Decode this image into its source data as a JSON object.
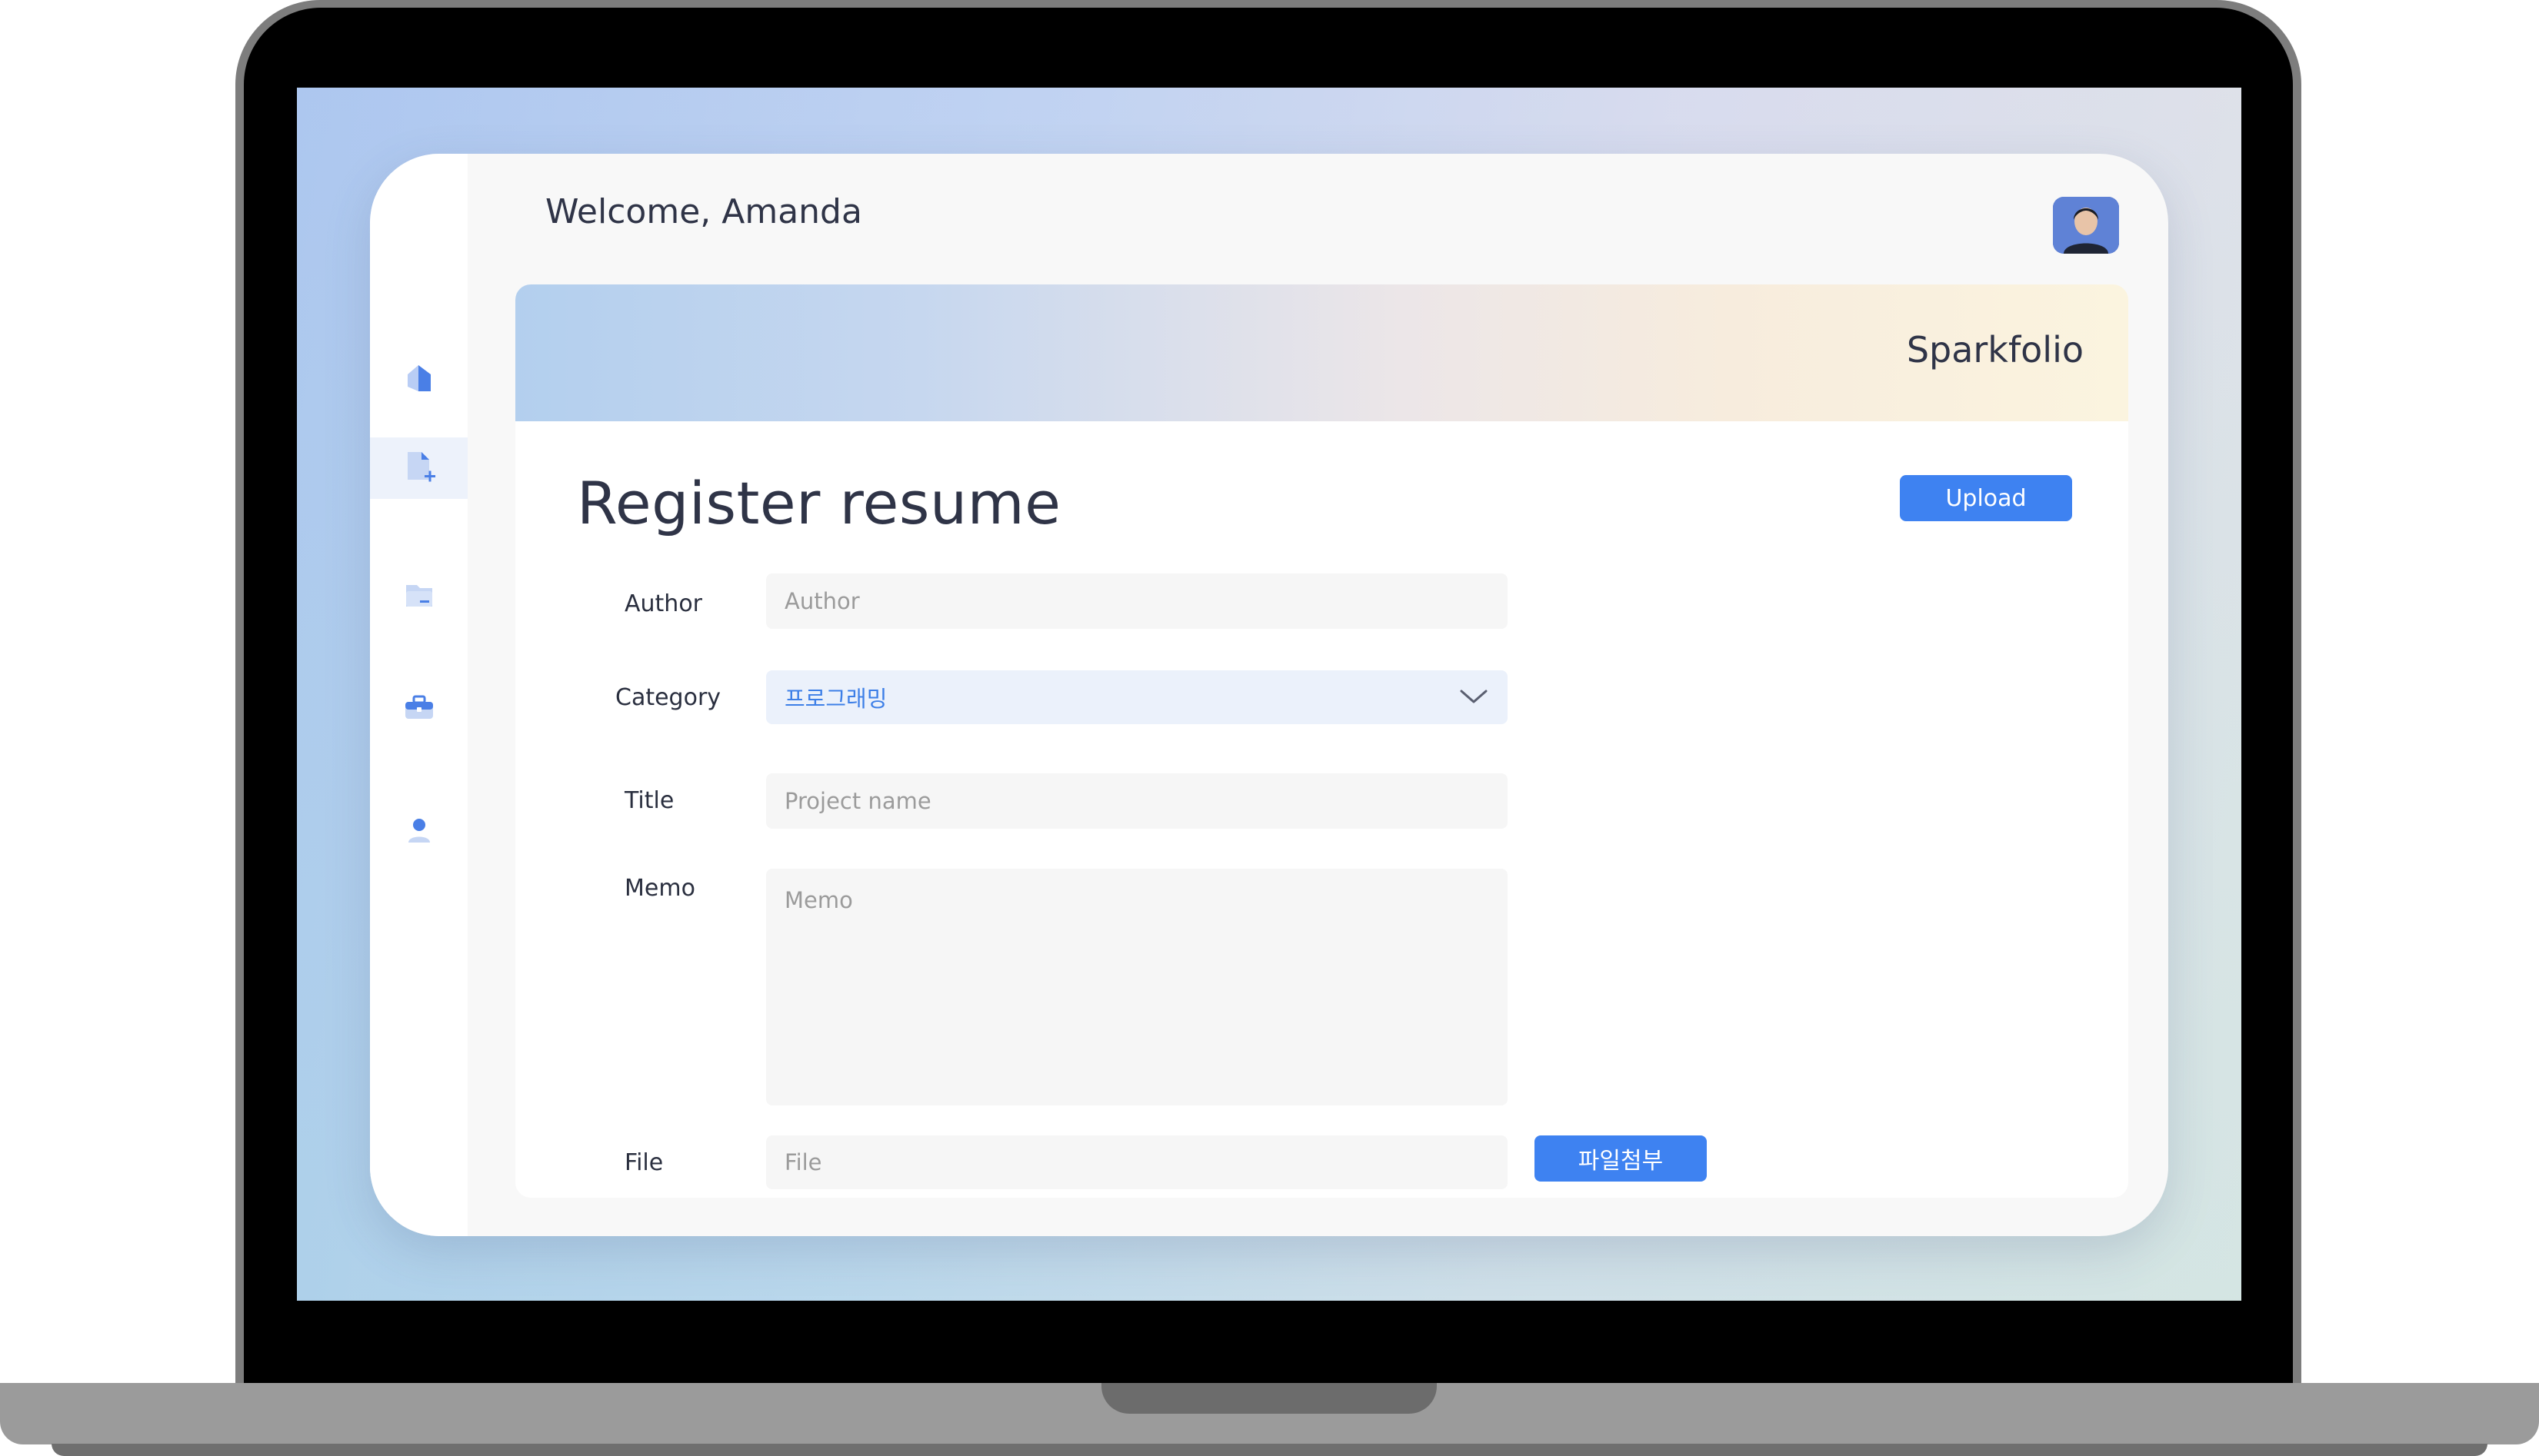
{
  "header": {
    "welcome": "Welcome, Amanda"
  },
  "banner": {
    "brand": "Sparkfolio"
  },
  "sidebar": {
    "items": [
      {
        "icon": "home-icon",
        "active": false
      },
      {
        "icon": "add-document-icon",
        "active": true
      },
      {
        "icon": "folder-icon",
        "active": false
      },
      {
        "icon": "briefcase-icon",
        "active": false
      },
      {
        "icon": "user-icon",
        "active": false
      }
    ]
  },
  "form": {
    "title": "Register resume",
    "upload_label": "Upload",
    "author": {
      "label": "Author",
      "placeholder": "Author",
      "value": ""
    },
    "category": {
      "label": "Category",
      "selected": "프로그래밍",
      "icon": "chevron-down-icon"
    },
    "title_field": {
      "label": "Title",
      "placeholder": "Project name",
      "value": ""
    },
    "memo": {
      "label": "Memo",
      "placeholder": "Memo",
      "value": ""
    },
    "file": {
      "label": "File",
      "placeholder": "File",
      "attach_label": "파일첨부"
    }
  },
  "colors": {
    "accent": "#3e82f1",
    "text": "#2f3447",
    "field_bg": "#f6f6f6",
    "select_bg": "#ebf1fb"
  }
}
